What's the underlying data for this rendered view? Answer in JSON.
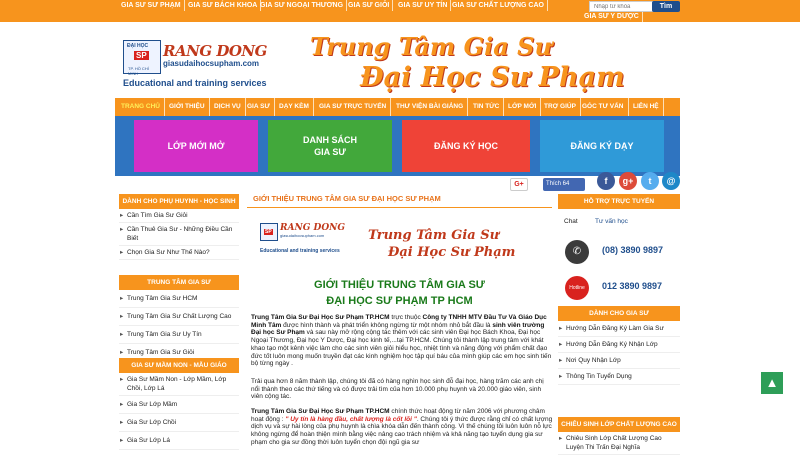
{
  "topnav": {
    "items": [
      "GIA SƯ SƯ PHẠM",
      "GIA SƯ BÁCH KHOA",
      "GIA SƯ NGOẠI THƯƠNG",
      "GIA SƯ GIỎI",
      "GIA SƯ UY TÍN",
      "GIA SƯ CHẤT LƯỢNG CAO",
      "GIA SƯ Y DƯỢC"
    ],
    "search_placeholder": "Nhập từ khóa",
    "search_button": "Tìm"
  },
  "header": {
    "logo_badge_top": "ĐẠI HỌC",
    "logo_badge_sp": "SP",
    "logo_badge_bottom": "TP. HỒ CHÍ MINH",
    "brand": "RANG DONG",
    "url": "giasudaihocsupham.com",
    "tagline": "Educational and training services",
    "slogan_line1": "Trung Tâm Gia Sư",
    "slogan_line2": "Đại Học Sư Phạm"
  },
  "mainnav": {
    "items": [
      "TRANG CHỦ",
      "GIỚI THIỆU",
      "DỊCH VỤ",
      "GIA SƯ",
      "DẠY KÈM",
      "GIA SƯ TRỰC TUYẾN",
      "THƯ VIỆN BÀI GIẢNG",
      "TIN TỨC",
      "LỚP MỚI",
      "TRỢ GIÚP",
      "GÓC TƯ VẤN",
      "LIÊN HỆ"
    ]
  },
  "tiles": {
    "t1": "LỚP MỚI MỞ",
    "t2": "DANH SÁCH\nGIA SƯ",
    "t3": "ĐĂNG KÝ HỌC",
    "t4": "ĐĂNG KÝ DẠY"
  },
  "social": {
    "gplus": "G+",
    "fb_like": "Thích 64",
    "facebook": "f",
    "googleplus": "g+",
    "twitter": "t",
    "email": "@"
  },
  "left": {
    "sec1_title": "DÀNH CHO PHỤ HUYNH - HỌC SINH",
    "sec1_items": [
      "Cần Tìm Gia Sư Giỏi",
      "Cần Thuê Gia Sư - Những Điều Cần Biết",
      "Chọn Gia Sư Như Thế Nào?"
    ],
    "sec2_title": "TRUNG TÂM GIA SƯ",
    "sec2_items": [
      "Trung Tâm Gia Sư HCM",
      "Trung Tâm Gia Sư Chất Lượng Cao",
      "Trung Tâm Gia Sư Uy Tín",
      "Trung Tâm Gia Sư Giỏi"
    ],
    "sec3_title": "GIA SƯ MẦM NON - MẪU GIÁO",
    "sec3_items": [
      "Gia Sư Mầm Non - Lớp Mầm, Lớp Chồi, Lớp Lá",
      "Gia Sư Lớp Mầm",
      "Gia Sư Lớp Chồi",
      "Gia Sư Lớp Lá"
    ]
  },
  "content": {
    "title": "GIỚI THIỆU TRUNG TÂM GIA SƯ ĐẠI HỌC SƯ PHẠM",
    "heading_line1": "GIỚI THIỆU TRUNG TÂM GIA SƯ",
    "heading_line2": "ĐẠI HỌC SƯ PHẠM TP HCM",
    "p1_bold_start": "Trung Tâm Gia Sư Đại Học Sư Phạm TP.HCM",
    "p1_mid": " trực thuộc ",
    "p1_bold_company": "Công ty TNHH MTV Đầu Tư Và Giáo Dục Minh Tâm",
    "p1_rest": " được hình thành và phát triển không ngừng từ một nhóm nhỏ bắt đầu là ",
    "p1_bold_students": "sinh viên trường Đại học Sư Phạm",
    "p1_end": " và sau này mở rộng cộng tác thêm với các sinh viên Đại học Bách Khoa, Đại học Ngoại Thương, Đại học Y Dược, Đại học kinh tế,...tại TP.HCM. Chúng tôi thành lập trung tâm với khát khao tạo một kênh việc làm cho các sinh viên giỏi hiểu học, nhiệt tình và năng động với phẩm chất đạo đức tốt luôn mong muốn truyền đạt các kinh nghiệm học tập quí báu của mình giúp các em học sinh tiến bộ từng ngày .",
    "p2": "Trải qua hơn 8 năm thành lập, chúng tôi đã có hàng nghìn học sinh đỗ đại học, hàng trăm các anh chị nổi thành theo các thứ tiếng và có được trải tìm của hơn 10.000 phụ huynh và 20.000 giáo viên, sinh viên cộng tác.",
    "p3_bold": "Trung Tâm Gia Sư Đại Học Sư Phạm TP.HCM",
    "p3_mid": " chính thức hoạt động từ năm 2006 với phương châm hoạt động : ",
    "p3_hl": "\" Uy tín là hàng đầu, chất lượng là cốt lõi \"",
    "p3_end": ". Chúng tôi ý thức được rằng chỉ có chất lượng dịch vụ và sự hài lòng của phụ huynh là chìa khóa dẫn đến thành công. Vì thế chúng tôi luôn luôn nỗ lực không ngừng để hoàn thiện mình bằng việc nâng cao trách nhiệm và khả năng tạo tuyển dụng gia sư phạm cho gia sư đồng thời luôn tuyển chọn đội ngũ gia sư"
  },
  "right": {
    "support_title": "HỖ TRỢ TRỰC TUYẾN",
    "chat_label": "Chat",
    "chat_text": "Tư vấn học",
    "phone1": "(08) 3890 9897",
    "phone2": "012 3890 9897",
    "hotline_label": "Hotline",
    "tutor_title": "DÀNH CHO GIA SƯ",
    "tutor_items": [
      "Hướng Dẫn Đăng Ký Làm Gia Sư",
      "Hướng Dẫn Đăng Ký Nhận Lớp",
      "Nơi Quy Nhận Lớp",
      "Thông Tin Tuyển Dụng"
    ],
    "quality_title": "CHIÊU SINH LỚP CHẤT LƯỢNG CAO",
    "quality_items": [
      "Chiêu Sinh Lớp Chất Lượng Cao Luyện Thi Trấn Đại Nghĩa"
    ]
  },
  "gotop_icon": "chevron-up-icon"
}
